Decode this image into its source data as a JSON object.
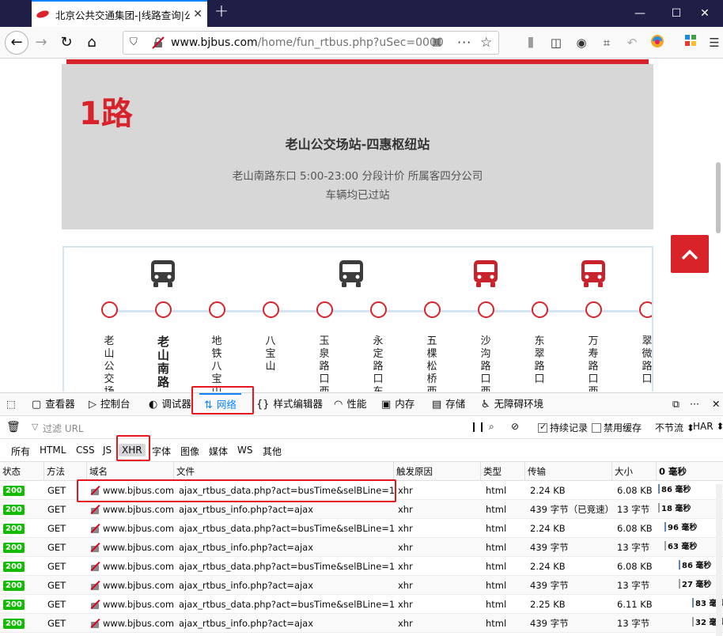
{
  "browser": {
    "tab_title": "北京公共交通集团-|线路查询|公",
    "url_host": "www.bjbus.com",
    "url_path": "/home/fun_rtbus.php?uSec=0000"
  },
  "page": {
    "route_name": "1路",
    "stations": "老山公交场站-四惠枢纽站",
    "info": "老山南路东口 5:00-23:00 分段计价 所属客四分公司",
    "status": "车辆均已过站",
    "stops": [
      {
        "name": "老山公交场",
        "bold": false
      },
      {
        "name": "老山南路",
        "bold": true
      },
      {
        "name": "地铁八宝山",
        "bold": false
      },
      {
        "name": "八宝山",
        "bold": false
      },
      {
        "name": "玉泉路口西",
        "bold": false
      },
      {
        "name": "永定路口东",
        "bold": false
      },
      {
        "name": "五棵松桥西",
        "bold": false
      },
      {
        "name": "沙沟路口西",
        "bold": false
      },
      {
        "name": "东翠路口",
        "bold": false
      },
      {
        "name": "万寿路口西",
        "bold": false
      },
      {
        "name": "翠微路口",
        "bold": false
      }
    ],
    "buses": [
      {
        "stop_index": 1,
        "color": "#3c3c3c"
      },
      {
        "stop_index": 4.5,
        "color": "#3c3c3c"
      },
      {
        "stop_index": 7,
        "color": "#c8232c"
      },
      {
        "stop_index": 9,
        "color": "#c8232c"
      }
    ]
  },
  "devtools": {
    "tabs": [
      "查看器",
      "控制台",
      "调试器",
      "网络",
      "样式编辑器",
      "性能",
      "内存",
      "存储",
      "无障碍环境"
    ],
    "selected_tab": "网络",
    "filter_placeholder": "过滤 URL",
    "persist_logs": "持续记录",
    "disable_cache": "禁用缓存",
    "throttle": "不节流",
    "har": "HAR",
    "type_filters": [
      "所有",
      "HTML",
      "CSS",
      "JS",
      "XHR",
      "字体",
      "图像",
      "媒体",
      "WS",
      "其他"
    ],
    "selected_type": "XHR",
    "columns": [
      "状态",
      "方法",
      "域名",
      "文件",
      "触发原因",
      "类型",
      "传输",
      "大小",
      "0 毫秒"
    ],
    "rows": [
      {
        "status": "200",
        "method": "GET",
        "domain": "www.bjbus.com",
        "file": "ajax_rtbus_data.php?act=busTime&selBLine=1&...",
        "cause": "xhr",
        "type": "html",
        "transfer": "2.24 KB",
        "size": "6.08 KB",
        "time": "86 毫秒"
      },
      {
        "status": "200",
        "method": "GET",
        "domain": "www.bjbus.com",
        "file": "ajax_rtbus_info.php?act=ajax",
        "cause": "xhr",
        "type": "html",
        "transfer": "439 字节（已竞速）",
        "size": "13 字节",
        "time": "18 毫秒"
      },
      {
        "status": "200",
        "method": "GET",
        "domain": "www.bjbus.com",
        "file": "ajax_rtbus_data.php?act=busTime&selBLine=1&...",
        "cause": "xhr",
        "type": "html",
        "transfer": "2.24 KB",
        "size": "6.08 KB",
        "time": "96 毫秒"
      },
      {
        "status": "200",
        "method": "GET",
        "domain": "www.bjbus.com",
        "file": "ajax_rtbus_info.php?act=ajax",
        "cause": "xhr",
        "type": "html",
        "transfer": "439 字节",
        "size": "13 字节",
        "time": "63 毫秒"
      },
      {
        "status": "200",
        "method": "GET",
        "domain": "www.bjbus.com",
        "file": "ajax_rtbus_data.php?act=busTime&selBLine=1&...",
        "cause": "xhr",
        "type": "html",
        "transfer": "2.24 KB",
        "size": "6.08 KB",
        "time": "86 毫秒"
      },
      {
        "status": "200",
        "method": "GET",
        "domain": "www.bjbus.com",
        "file": "ajax_rtbus_info.php?act=ajax",
        "cause": "xhr",
        "type": "html",
        "transfer": "439 字节",
        "size": "13 字节",
        "time": "27 毫秒"
      },
      {
        "status": "200",
        "method": "GET",
        "domain": "www.bjbus.com",
        "file": "ajax_rtbus_data.php?act=busTime&selBLine=1&...",
        "cause": "xhr",
        "type": "html",
        "transfer": "2.25 KB",
        "size": "6.11 KB",
        "time": "83 毫秒"
      },
      {
        "status": "200",
        "method": "GET",
        "domain": "www.bjbus.com",
        "file": "ajax_rtbus_info.php?act=ajax",
        "cause": "xhr",
        "type": "html",
        "transfer": "439 字节",
        "size": "13 字节",
        "time": "32 毫秒"
      }
    ],
    "waterfall_offsets": [
      0,
      0,
      0.12,
      0.12,
      0.37,
      0.37,
      0.61,
      0.61
    ]
  },
  "colors": {
    "brand_red": "#d8232a",
    "firefox_blue": "#0a84ff",
    "status_green": "#12bc00",
    "annotation_red": "#e8161f"
  }
}
